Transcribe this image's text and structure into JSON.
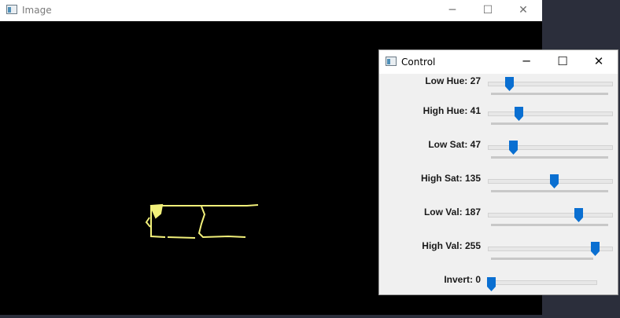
{
  "image_window": {
    "title": "Image",
    "controls": {
      "minimize": "─",
      "maximize": "☐",
      "close": "✕"
    },
    "icon": "app-window-icon"
  },
  "control_window": {
    "title": "Control",
    "controls": {
      "minimize": "─",
      "maximize": "☐",
      "close": "✕"
    },
    "icon": "app-window-icon",
    "thumb_color": "#0a6fd1",
    "trackbars": [
      {
        "label": "Low Hue: 27",
        "value": 27,
        "max": 179
      },
      {
        "label": "High Hue: 41",
        "value": 41,
        "max": 179
      },
      {
        "label": "Low Sat: 47",
        "value": 47,
        "max": 255
      },
      {
        "label": "High Sat: 135",
        "value": 135,
        "max": 255
      },
      {
        "label": "Low Val: 187",
        "value": 187,
        "max": 255
      },
      {
        "label": "High Val: 255",
        "value": 255,
        "max": 255
      },
      {
        "label": "Invert: 0",
        "value": 0,
        "max": 1
      }
    ]
  },
  "mask_color": "#f2f07a"
}
